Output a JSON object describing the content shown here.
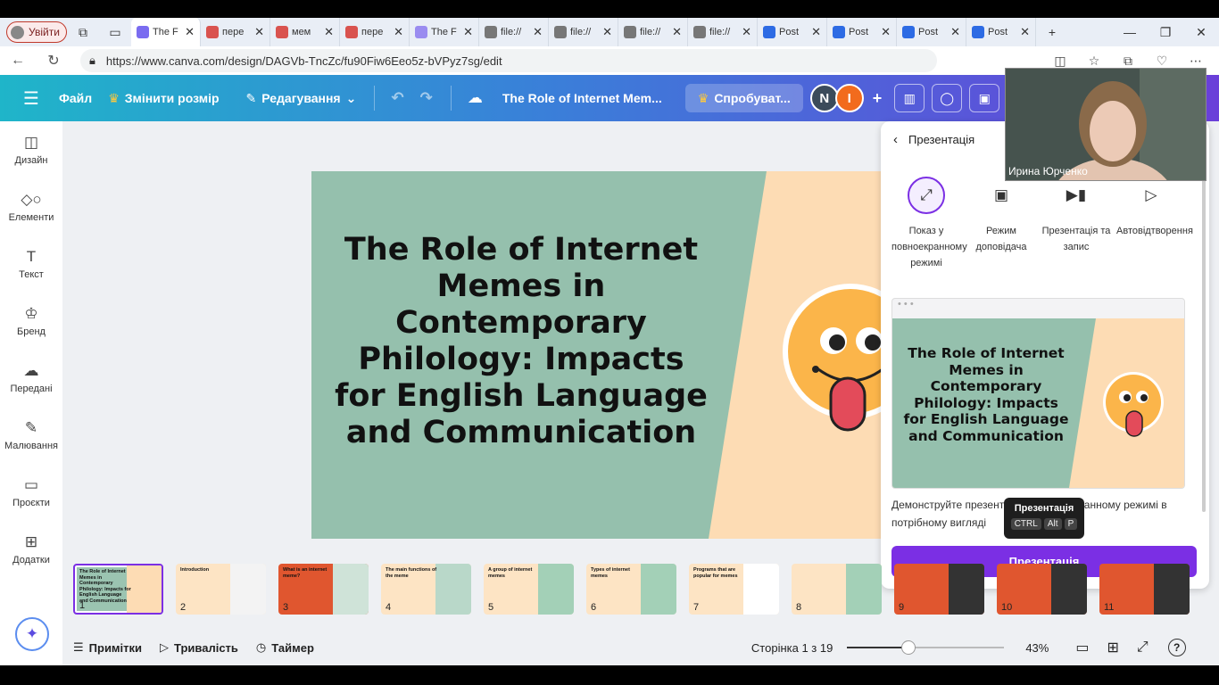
{
  "browser": {
    "profile_label": "Увійти",
    "tabs": [
      {
        "label": "The F",
        "active": true,
        "favicon_color": "#7a6cf0"
      },
      {
        "label": "пере",
        "favicon_color": "#d9534f"
      },
      {
        "label": "мем",
        "favicon_color": "#d9534f"
      },
      {
        "label": "пере",
        "favicon_color": "#d9534f"
      },
      {
        "label": "The F",
        "favicon_color": "#9a8cf0"
      },
      {
        "label": "file://",
        "favicon_color": "#777777"
      },
      {
        "label": "file://",
        "favicon_color": "#777777"
      },
      {
        "label": "file://",
        "favicon_color": "#777777"
      },
      {
        "label": "file://",
        "favicon_color": "#777777"
      },
      {
        "label": "Post",
        "favicon_color": "#2d6be4"
      },
      {
        "label": "Post",
        "favicon_color": "#2d6be4"
      },
      {
        "label": "Post",
        "favicon_color": "#2d6be4"
      },
      {
        "label": "Post",
        "favicon_color": "#2d6be4"
      }
    ],
    "tab_close_glyph": "✕",
    "new_tab_glyph": "+",
    "url": "https://www.canva.com/design/DAGVb-TncZc/fu90Fiw6Eeo5z-bVPyz7sg/edit"
  },
  "canva": {
    "menu_file": "Файл",
    "resize": "Змінити розмір",
    "editing": "Редагування",
    "doc_title": "The Role of Internet Mem...",
    "try_label": "Спробуват...",
    "collab_initials": [
      "N",
      "I"
    ]
  },
  "sidebar": {
    "items": [
      {
        "label": "Дизайн",
        "icon": "design-icon",
        "glyph": "◫"
      },
      {
        "label": "Елементи",
        "icon": "elements-icon",
        "glyph": "◇○"
      },
      {
        "label": "Текст",
        "icon": "text-icon",
        "glyph": "T"
      },
      {
        "label": "Бренд",
        "icon": "brand-icon",
        "glyph": "♔"
      },
      {
        "label": "Передані",
        "icon": "upload-icon",
        "glyph": "☁"
      },
      {
        "label": "Малювання",
        "icon": "draw-icon",
        "glyph": "✎"
      },
      {
        "label": "Проєкти",
        "icon": "folder-icon",
        "glyph": "▭"
      },
      {
        "label": "Додатки",
        "icon": "apps-icon",
        "glyph": "⊞"
      }
    ]
  },
  "slide": {
    "title": "The Role of Internet Memes in Contemporary Philology: Impacts for English Language and Communication"
  },
  "present_panel": {
    "title": "Презентація",
    "options": [
      {
        "label": "Показ у повноекранному режимі",
        "icon": "fullscreen-icon",
        "glyph": "⤢"
      },
      {
        "label": "Режим доповідача",
        "icon": "presenter-icon",
        "glyph": "▣"
      },
      {
        "label": "Презентація та запис",
        "icon": "record-icon",
        "glyph": "▶▮"
      },
      {
        "label": "Автовідтворення",
        "icon": "play-icon",
        "glyph": "▷"
      }
    ],
    "description": "Демонструйте презентацію в повноекранному режимі в потрібному вигляді",
    "tooltip_title": "Презентація",
    "tooltip_keys": [
      "CTRL",
      "Alt",
      "P"
    ],
    "button": "Презентація"
  },
  "video": {
    "name": "Ирина Юрченко"
  },
  "thumbnails": [
    {
      "num": "1",
      "title": "The Role of Internet Memes in Contemporary Philology: Impacts for English Language and Communication",
      "bg": "#9bc4b1",
      "accent": "#fddcb4"
    },
    {
      "num": "2",
      "title": "Introduction",
      "bg": "#fde4c4",
      "accent": "#f3f3f3"
    },
    {
      "num": "3",
      "title": "What is an internet meme?",
      "bg": "#e0562f",
      "accent": "#cfe3d8"
    },
    {
      "num": "4",
      "title": "The main functions of the meme",
      "bg": "#fde4c4",
      "accent": "#b9d8c9"
    },
    {
      "num": "5",
      "title": "A group of internet memes",
      "bg": "#fde4c4",
      "accent": "#a3d0b7"
    },
    {
      "num": "6",
      "title": "Types of internet memes",
      "bg": "#fde4c4",
      "accent": "#a3d0b7"
    },
    {
      "num": "7",
      "title": "Programs that are popular for memes",
      "bg": "#fde4c4",
      "accent": "#ffffff"
    },
    {
      "num": "8",
      "title": "",
      "bg": "#fde4c4",
      "accent": "#a3d0b7"
    },
    {
      "num": "9",
      "title": "",
      "bg": "#e0562f",
      "accent": "#333333"
    },
    {
      "num": "10",
      "title": "",
      "bg": "#e0562f",
      "accent": "#333333"
    },
    {
      "num": "11",
      "title": "",
      "bg": "#e0562f",
      "accent": "#333333"
    }
  ],
  "bottom": {
    "notes": "Примітки",
    "duration": "Тривалість",
    "timer": "Таймер",
    "page": "Сторінка 1 з 19",
    "zoom_percent": 43,
    "zoom_label": "43%",
    "help": "?"
  }
}
